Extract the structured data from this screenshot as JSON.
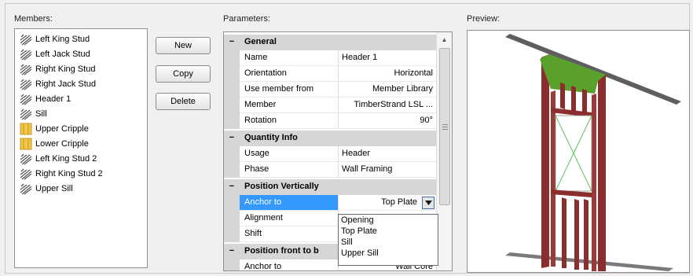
{
  "members": {
    "label": "Members:",
    "items": [
      {
        "label": "Left King Stud",
        "icon": "stud-icon"
      },
      {
        "label": "Left Jack Stud",
        "icon": "stud-icon"
      },
      {
        "label": "Right King Stud",
        "icon": "stud-icon"
      },
      {
        "label": "Right Jack Stud",
        "icon": "stud-icon"
      },
      {
        "label": "Header 1",
        "icon": "stud-icon"
      },
      {
        "label": "Sill",
        "icon": "stud-icon"
      },
      {
        "label": "Upper Cripple",
        "icon": "cripple-icon"
      },
      {
        "label": "Lower Cripple",
        "icon": "cripple-icon"
      },
      {
        "label": "Left King Stud 2",
        "icon": "stud-icon"
      },
      {
        "label": "Right King Stud 2",
        "icon": "stud-icon"
      },
      {
        "label": "Upper Sill",
        "icon": "stud-icon"
      }
    ]
  },
  "buttons": {
    "new": "New",
    "copy": "Copy",
    "delete": "Delete"
  },
  "parameters": {
    "label": "Parameters:",
    "categories": {
      "general": "General",
      "quantity": "Quantity Info",
      "position_vertically": "Position Vertically",
      "position_front": "Position front to b"
    },
    "toggle": "−",
    "rows": {
      "name": {
        "name": "Name",
        "value": "Header 1"
      },
      "orientation": {
        "name": "Orientation",
        "value": "Horizontal"
      },
      "use_member_from": {
        "name": "Use member from",
        "value": "Member Library"
      },
      "member": {
        "name": "Member",
        "value": "TimberStrand LSL ..."
      },
      "rotation": {
        "name": "Rotation",
        "value": "90°"
      },
      "usage": {
        "name": "Usage",
        "value": "Header"
      },
      "phase": {
        "name": "Phase",
        "value": "Wall Framing"
      },
      "anchor_to": {
        "name": "Anchor to",
        "value": "Top Plate"
      },
      "alignment": {
        "name": "Alignment",
        "value": ""
      },
      "shift": {
        "name": "Shift",
        "value": ""
      },
      "anchor_to_2": {
        "name": "Anchor to",
        "value": "Wall Core"
      }
    },
    "dropdown_options": [
      "Opening",
      "Top Plate",
      "Sill",
      "Upper Sill"
    ]
  },
  "preview": {
    "label": "Preview:"
  },
  "colors": {
    "selection": "#3399ff",
    "stud": "#8b2d2d",
    "header": "#5aa02c",
    "plate": "#6e6e6e"
  }
}
